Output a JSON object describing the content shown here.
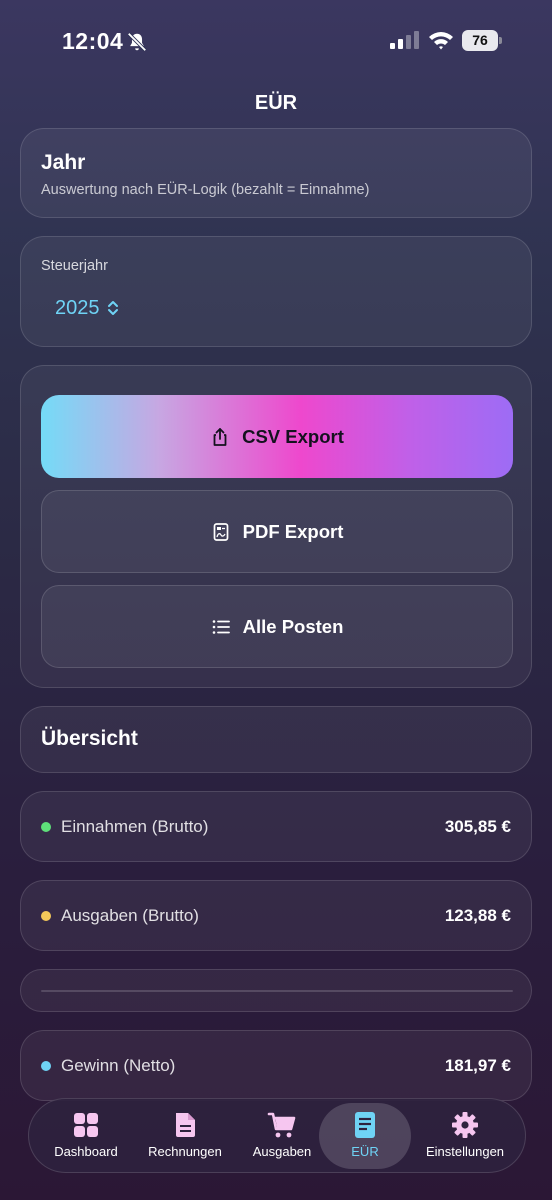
{
  "status_bar": {
    "time": "12:04",
    "battery": "76"
  },
  "nav": {
    "title": "EÜR"
  },
  "year_card": {
    "title": "Jahr",
    "subtitle": "Auswertung nach EÜR-Logik (bezahlt = Einnahme)"
  },
  "tax_year": {
    "label": "Steuerjahr",
    "value": "2025"
  },
  "actions": {
    "csv": "CSV Export",
    "pdf": "PDF Export",
    "all": "Alle Posten"
  },
  "overview": {
    "title": "Übersicht",
    "income": {
      "label": "Einnahmen (Brutto)",
      "value": "305,85 €",
      "color": "#5ee07a"
    },
    "expenses": {
      "label": "Ausgaben (Brutto)",
      "value": "123,88 €",
      "color": "#f4c95a"
    },
    "profit": {
      "label": "Gewinn (Netto)",
      "value": "181,97 €",
      "color": "#6fd3f5"
    }
  },
  "tabs": [
    {
      "label": "Dashboard",
      "icon": "grid-icon"
    },
    {
      "label": "Rechnungen",
      "icon": "document-icon"
    },
    {
      "label": "Ausgaben",
      "icon": "cart-icon"
    },
    {
      "label": "EÜR",
      "icon": "report-icon",
      "active": true
    },
    {
      "label": "Einstellungen",
      "icon": "gear-icon"
    }
  ],
  "colors": {
    "accent": "#6fd3f5"
  }
}
